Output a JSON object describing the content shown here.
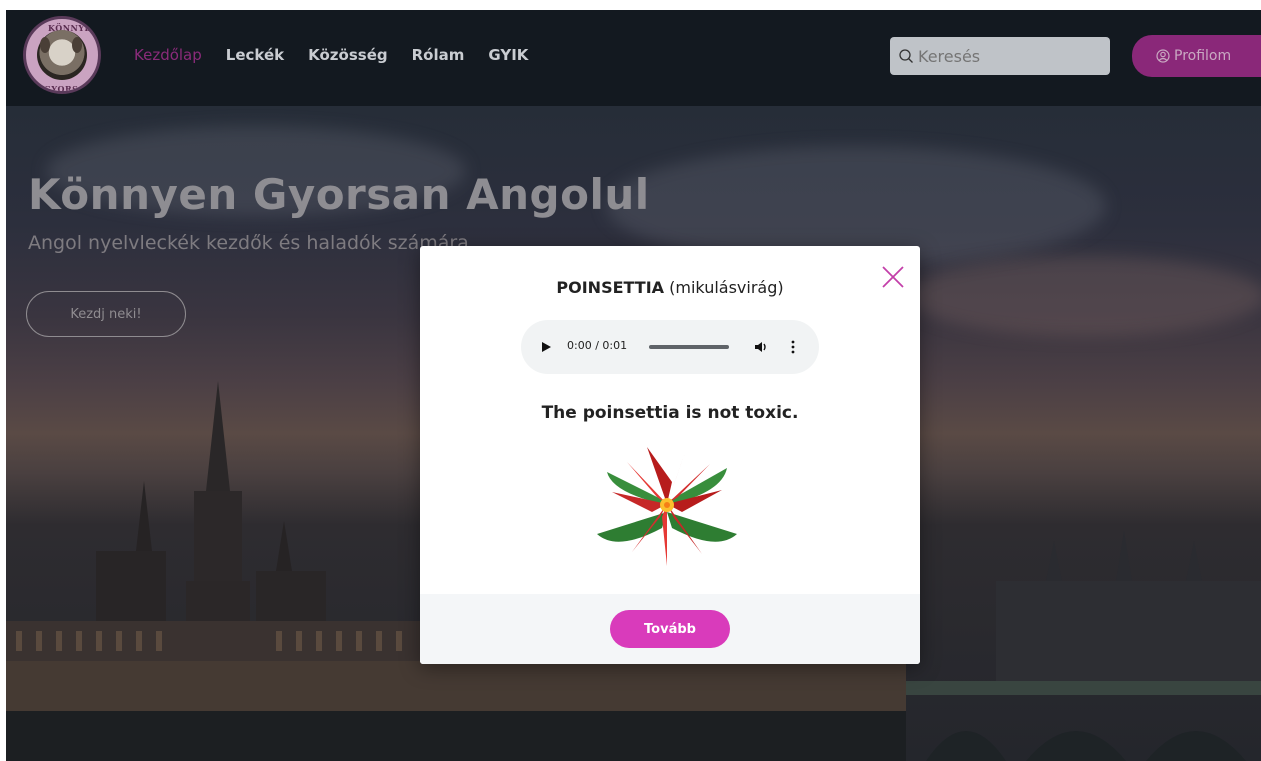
{
  "navbar": {
    "logo_top_text": "KÖNNYEN",
    "logo_bottom_text": "GYORSAN ANGOLUL",
    "links": [
      {
        "label": "Kezdőlap",
        "active": true
      },
      {
        "label": "Leckék",
        "active": false
      },
      {
        "label": "Közösség",
        "active": false
      },
      {
        "label": "Rólam",
        "active": false
      },
      {
        "label": "GYIK",
        "active": false
      }
    ],
    "search_placeholder": "Keresés",
    "profile_label": "Profilom"
  },
  "hero": {
    "title": "Könnyen Gyorsan Angolul",
    "subtitle": "Angol nyelvleckék kezdők és haladók számára",
    "cta_label": "Kezdj neki!"
  },
  "modal": {
    "word": "POINSETTIA",
    "translation": "(mikulásvirág)",
    "audio_time": "0:00 / 0:01",
    "sentence": "The poinsettia is not toxic.",
    "next_label": "Tovább",
    "image": "poinsettia-flower"
  },
  "colors": {
    "accent": "#d93bbb",
    "nav_active": "#8a2b7a",
    "navbar_bg": "#131920"
  }
}
